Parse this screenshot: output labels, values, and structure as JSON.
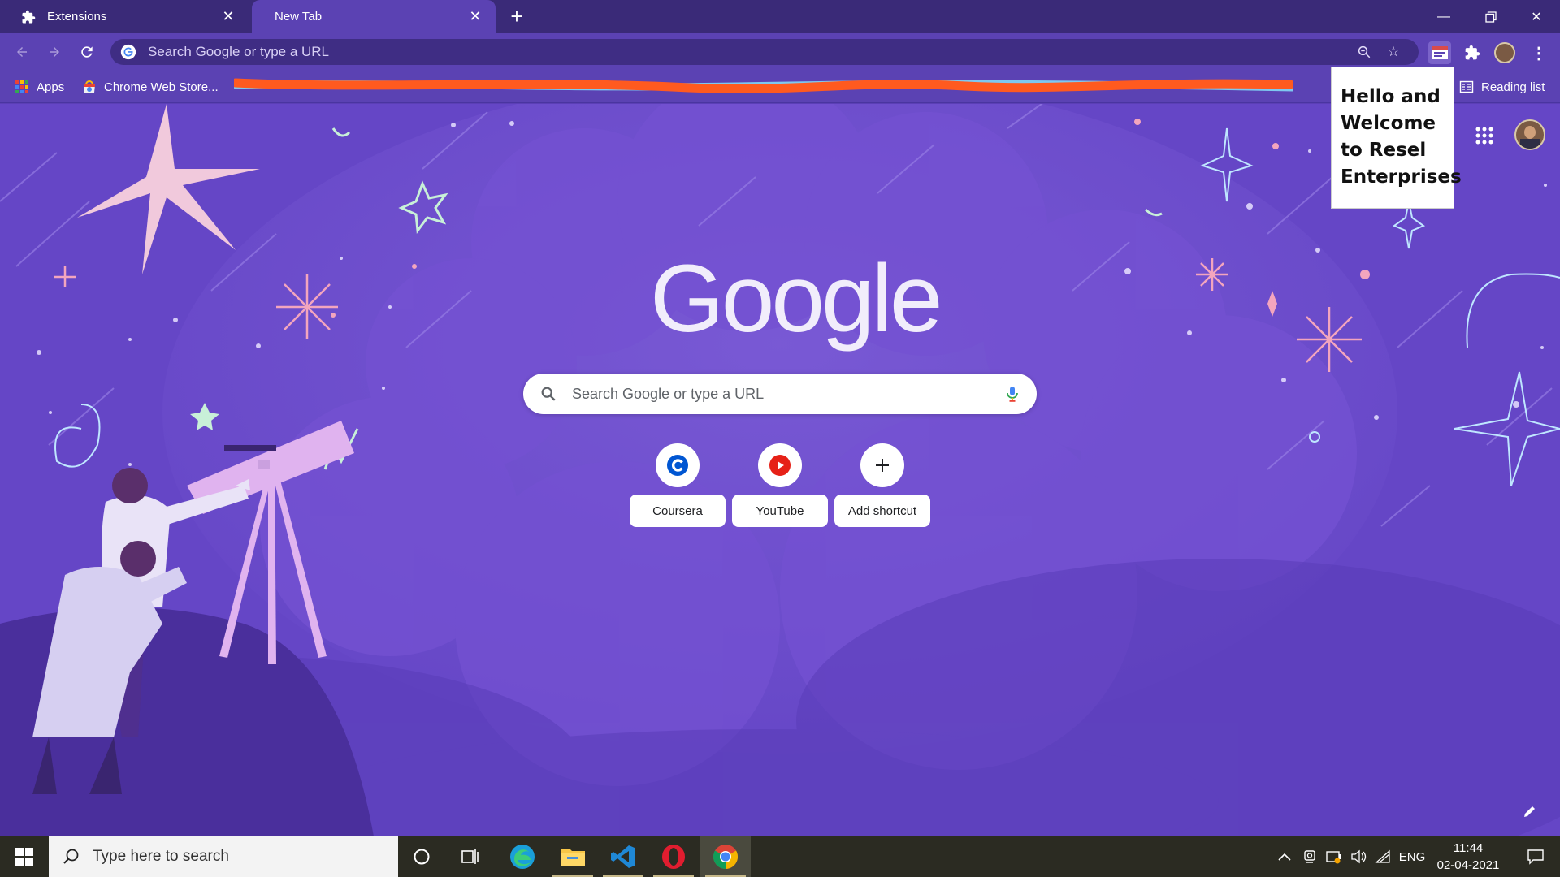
{
  "browser": {
    "tabs": [
      {
        "label": "Extensions",
        "icon": "puzzle-icon"
      },
      {
        "label": "New Tab",
        "icon": ""
      }
    ],
    "omnibox_placeholder": "Search Google or type a URL",
    "bookmarks": [
      {
        "label": "Apps",
        "icon": "apps-grid-icon"
      },
      {
        "label": "Chrome Web Store...",
        "icon": "chrome-web-store-icon"
      }
    ],
    "reading_list_label": "Reading list"
  },
  "ntp": {
    "logo_text": "Google",
    "search_placeholder": "Search Google or type a URL",
    "shortcuts": [
      {
        "label": "Coursera",
        "icon": "coursera-icon"
      },
      {
        "label": "YouTube",
        "icon": "youtube-icon"
      },
      {
        "label": "Add shortcut",
        "icon": "plus-icon"
      }
    ]
  },
  "popup": {
    "lines": [
      "Hello and",
      "Welcome",
      "to Resel",
      "Enterprises"
    ]
  },
  "taskbar": {
    "search_placeholder": "Type here to search",
    "language": "ENG",
    "time": "11:44",
    "date": "02-04-2021"
  },
  "colors": {
    "tabstrip": "#3a2a78",
    "toolbar": "#5b42b3",
    "ntp_background": "#6647c7",
    "taskbar": "#2b2b22"
  }
}
